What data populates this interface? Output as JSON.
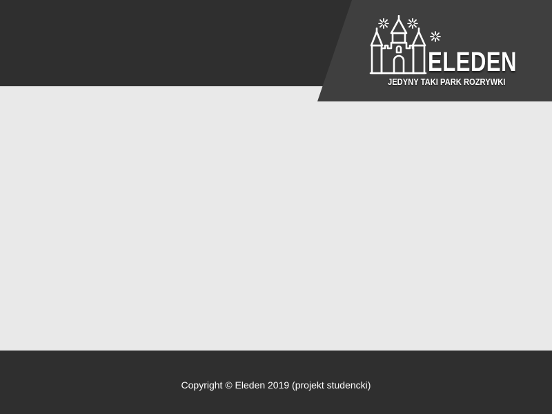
{
  "header": {
    "brand_name": "ELEDEN",
    "tagline": "JEDYNY TAKI PARK ROZRYWKI",
    "logo_icon": "castle-with-fireworks-icon"
  },
  "footer": {
    "copyright": "Copyright © Eleden 2019 (projekt studencki)"
  },
  "colors": {
    "header_background": "#2f2f2f",
    "logo_panel_background": "#3f3f3f",
    "content_background": "#e9e9e9",
    "footer_background": "#2f2f2f",
    "text": "#ffffff"
  }
}
